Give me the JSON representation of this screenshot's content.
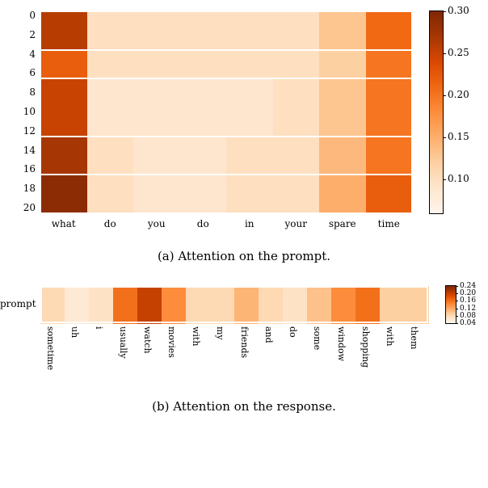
{
  "chart_data": [
    {
      "type": "heatmap",
      "title": "(a) Attention on the prompt.",
      "x_categories": [
        "what",
        "do",
        "you",
        "do",
        "in",
        "your",
        "spare",
        "time"
      ],
      "y_categories": [
        "0",
        "2",
        "4",
        "6",
        "8",
        "10",
        "12",
        "14",
        "16",
        "18",
        "20"
      ],
      "y_tick_indices": [
        0,
        2,
        4,
        6,
        8,
        10,
        12,
        14,
        16,
        18,
        20
      ],
      "row_groups": [
        [
          0,
          4
        ],
        [
          4,
          7
        ],
        [
          7,
          13
        ],
        [
          13,
          17
        ],
        [
          17,
          21
        ]
      ],
      "values": [
        [
          0.26,
          0.1,
          0.1,
          0.1,
          0.1,
          0.1,
          0.13,
          0.21
        ],
        [
          0.26,
          0.1,
          0.1,
          0.1,
          0.1,
          0.1,
          0.13,
          0.21
        ],
        [
          0.26,
          0.1,
          0.1,
          0.1,
          0.1,
          0.1,
          0.13,
          0.21
        ],
        [
          0.26,
          0.1,
          0.1,
          0.1,
          0.1,
          0.1,
          0.13,
          0.21
        ],
        [
          0.22,
          0.1,
          0.1,
          0.1,
          0.1,
          0.1,
          0.12,
          0.2
        ],
        [
          0.22,
          0.1,
          0.1,
          0.1,
          0.1,
          0.1,
          0.12,
          0.2
        ],
        [
          0.22,
          0.1,
          0.1,
          0.1,
          0.1,
          0.1,
          0.12,
          0.2
        ],
        [
          0.25,
          0.09,
          0.09,
          0.09,
          0.09,
          0.1,
          0.13,
          0.2
        ],
        [
          0.25,
          0.09,
          0.09,
          0.09,
          0.09,
          0.1,
          0.13,
          0.2
        ],
        [
          0.25,
          0.09,
          0.09,
          0.09,
          0.09,
          0.1,
          0.13,
          0.2
        ],
        [
          0.25,
          0.09,
          0.09,
          0.09,
          0.09,
          0.1,
          0.13,
          0.2
        ],
        [
          0.25,
          0.09,
          0.09,
          0.09,
          0.09,
          0.1,
          0.13,
          0.2
        ],
        [
          0.25,
          0.09,
          0.09,
          0.09,
          0.09,
          0.1,
          0.13,
          0.2
        ],
        [
          0.27,
          0.1,
          0.09,
          0.09,
          0.1,
          0.1,
          0.14,
          0.2
        ],
        [
          0.27,
          0.1,
          0.09,
          0.09,
          0.1,
          0.1,
          0.14,
          0.2
        ],
        [
          0.27,
          0.1,
          0.09,
          0.09,
          0.1,
          0.1,
          0.14,
          0.2
        ],
        [
          0.27,
          0.1,
          0.09,
          0.09,
          0.1,
          0.1,
          0.14,
          0.2
        ],
        [
          0.29,
          0.1,
          0.09,
          0.09,
          0.1,
          0.1,
          0.15,
          0.22
        ],
        [
          0.29,
          0.1,
          0.09,
          0.09,
          0.1,
          0.1,
          0.15,
          0.22
        ],
        [
          0.29,
          0.1,
          0.09,
          0.09,
          0.1,
          0.1,
          0.15,
          0.22
        ],
        [
          0.29,
          0.1,
          0.09,
          0.09,
          0.1,
          0.1,
          0.15,
          0.22
        ]
      ],
      "colorbar": {
        "min": 0.06,
        "max": 0.3,
        "ticks": [
          0.1,
          0.15,
          0.2,
          0.25,
          0.3
        ],
        "tick_labels": [
          "0.10",
          "0.15",
          "0.20",
          "0.25",
          "0.30"
        ]
      }
    },
    {
      "type": "heatmap",
      "title": "(b) Attention on the response.",
      "x_categories": [
        "sometime",
        "uh",
        "i",
        "usually",
        "watch",
        "movies",
        "with",
        "my",
        "friends",
        "and",
        "do",
        "some",
        "window",
        "shopping",
        "with",
        "them"
      ],
      "y_categories": [
        "prompt"
      ],
      "values": [
        [
          0.08,
          0.06,
          0.07,
          0.16,
          0.2,
          0.14,
          0.08,
          0.08,
          0.11,
          0.08,
          0.07,
          0.1,
          0.14,
          0.16,
          0.09,
          0.09
        ]
      ],
      "colorbar": {
        "min": 0.04,
        "max": 0.24,
        "ticks": [
          0.04,
          0.08,
          0.12,
          0.16,
          0.2,
          0.24
        ],
        "tick_labels": [
          "0.04",
          "0.08",
          "0.12",
          "0.16",
          "0.20",
          "0.24"
        ]
      }
    }
  ]
}
